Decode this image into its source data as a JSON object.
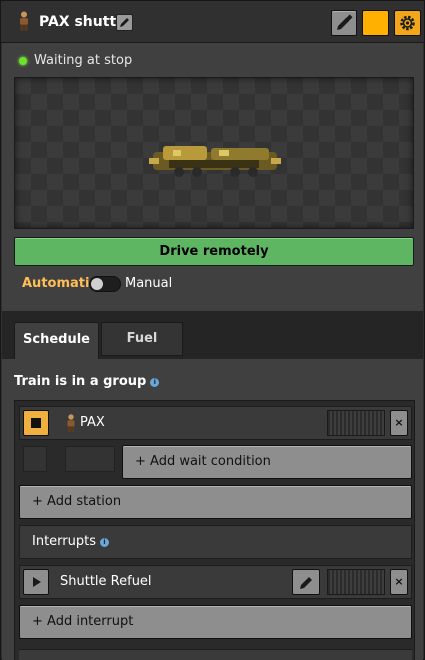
{
  "window": {
    "title": "PAX shuttle"
  },
  "status": {
    "text": "Waiting at stop"
  },
  "controls": {
    "drive_label": "Drive remotely",
    "automatic_label": "Automatic",
    "manual_label": "Manual",
    "mode_is_manual": false
  },
  "colors": {
    "train_color": "#ffb000",
    "status_dot": "#6ee12c",
    "drive_button": "#5eb663",
    "accent": "#ffbe56"
  },
  "tabs": [
    {
      "label": "Schedule",
      "active": true
    },
    {
      "label": "Fuel",
      "active": false
    }
  ],
  "schedule": {
    "group_label": "Train is in a group",
    "records": [
      {
        "station": "PAX",
        "add_wait_label": "+ Add wait condition",
        "close_label": "×"
      }
    ],
    "add_station_label": "+ Add station",
    "interrupts_label": "Interrupts",
    "interrupts": [
      {
        "name": "Shuttle Refuel",
        "close_label": "×"
      }
    ],
    "add_interrupt_label": "+ Add interrupt"
  }
}
